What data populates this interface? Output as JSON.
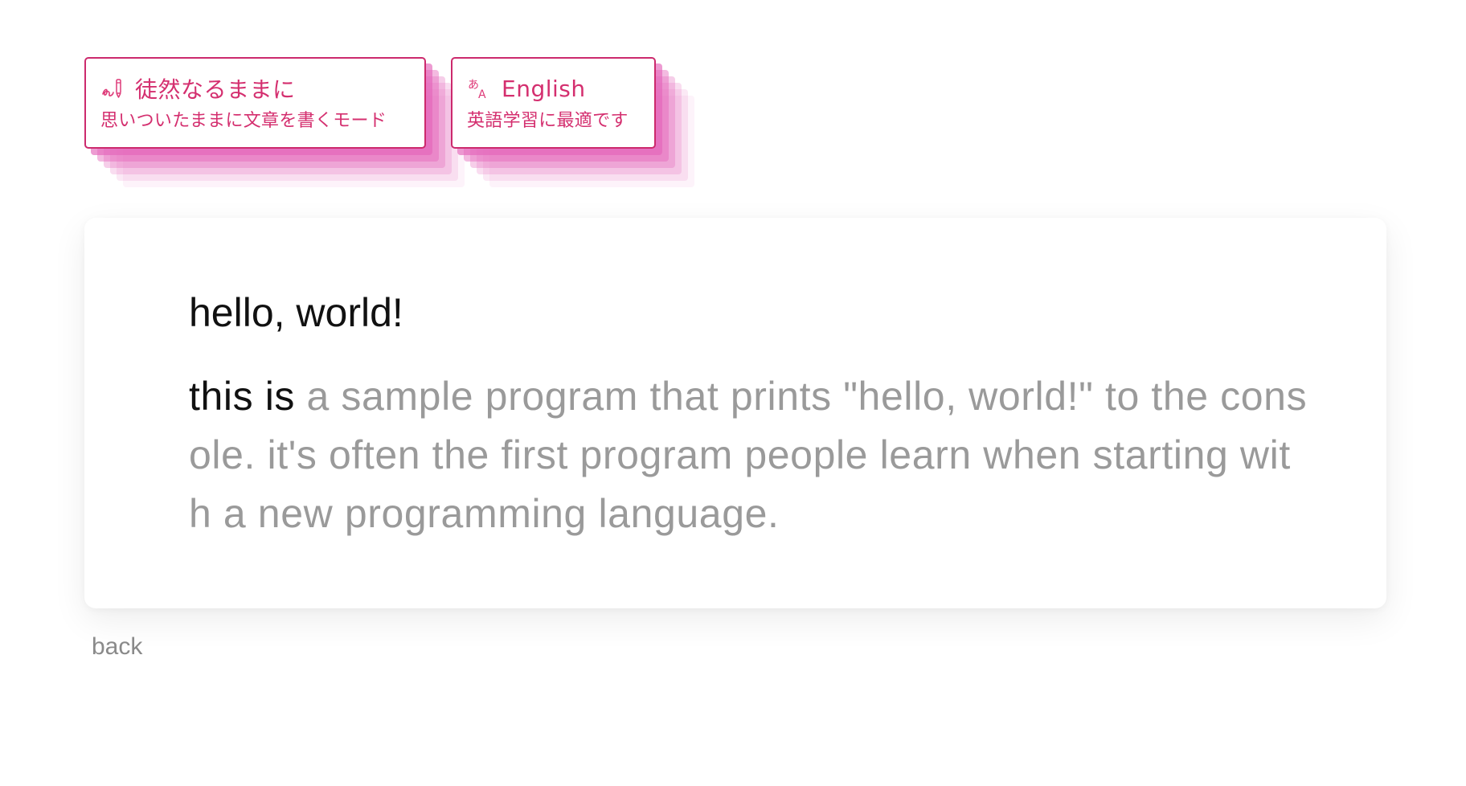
{
  "modes": [
    {
      "title": "徒然なるままに",
      "subtitle": "思いついたままに文章を書くモード",
      "icon": "handwriting-icon",
      "selected": true
    },
    {
      "title": "English",
      "subtitle": "英語学習に最適です",
      "icon": "translate-icon",
      "selected": false
    }
  ],
  "editor": {
    "title": "hello, world!",
    "typed_text": "this is",
    "suggestion_text": " a sample program that prints \"hello, world!\" to the console. it's often the first program people learn when starting with a new programming language."
  },
  "nav": {
    "back_label": "back"
  },
  "colors": {
    "accent": "#d42f6f",
    "card_border": "#cc2a6d",
    "stack_pink": "#e466ba",
    "typed_text": "#111111",
    "suggestion_text": "#9a9a9a",
    "back_link": "#8a8a8a"
  }
}
